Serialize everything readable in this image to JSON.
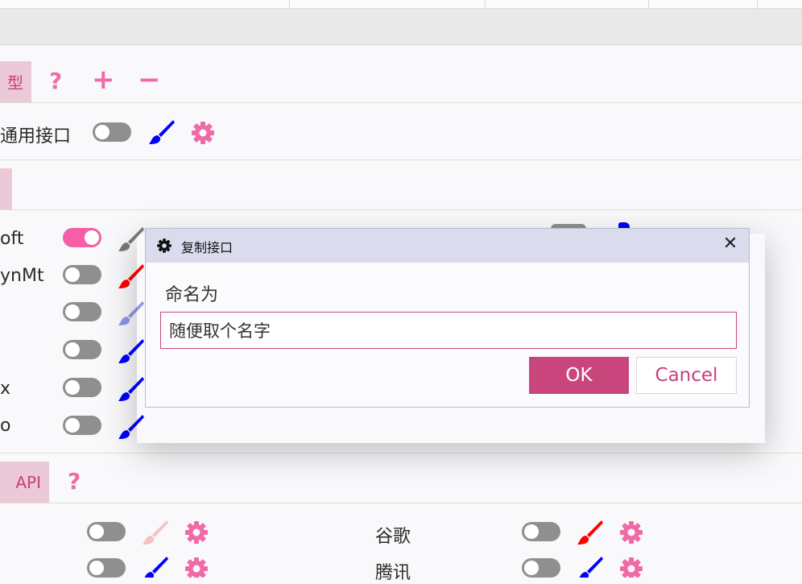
{
  "sections": {
    "model": {
      "tab_label": "型"
    },
    "api": {
      "tab_label": "API"
    }
  },
  "colors": {
    "accent": "#c9467c",
    "toggle_on": "#f45fa6",
    "icon_pink": "#f06aa8",
    "tab_bg": "#ecc9d6"
  },
  "model_actions": {
    "help": "?",
    "add": "+",
    "remove": "−"
  },
  "api_actions": {
    "help": "?"
  },
  "general_row": {
    "label": "通用接口",
    "enabled": false
  },
  "engine_rows": [
    {
      "label": "oft",
      "enabled": true,
      "brush_color": "#7a7a7a"
    },
    {
      "label": "ynMt",
      "enabled": false,
      "brush_color": "#ff0000"
    },
    {
      "label": "",
      "enabled": false,
      "brush_color": "#8d99ea"
    },
    {
      "label": "",
      "enabled": false,
      "brush_color": "#0000ff"
    },
    {
      "label": "x",
      "enabled": false,
      "brush_color": "#0000ff"
    },
    {
      "label": "o",
      "enabled": false,
      "brush_color": "#0000ff"
    }
  ],
  "api_rows": [
    {
      "label": "",
      "enabled": false,
      "brush_color": "#f7c0c4"
    },
    {
      "label": "谷歌",
      "enabled": false,
      "brush_color": "#ff0000"
    },
    {
      "label": "",
      "enabled": false,
      "brush_color": "#0000ff"
    },
    {
      "label": "腾讯",
      "enabled": false,
      "brush_color": "#0000ff"
    }
  ],
  "dialog": {
    "icon": "gear-icon",
    "title": "复制接口",
    "close_glyph": "✕",
    "field_label": "命名为",
    "input_value": "随便取个名字",
    "ok_label": "OK",
    "cancel_label": "Cancel"
  }
}
